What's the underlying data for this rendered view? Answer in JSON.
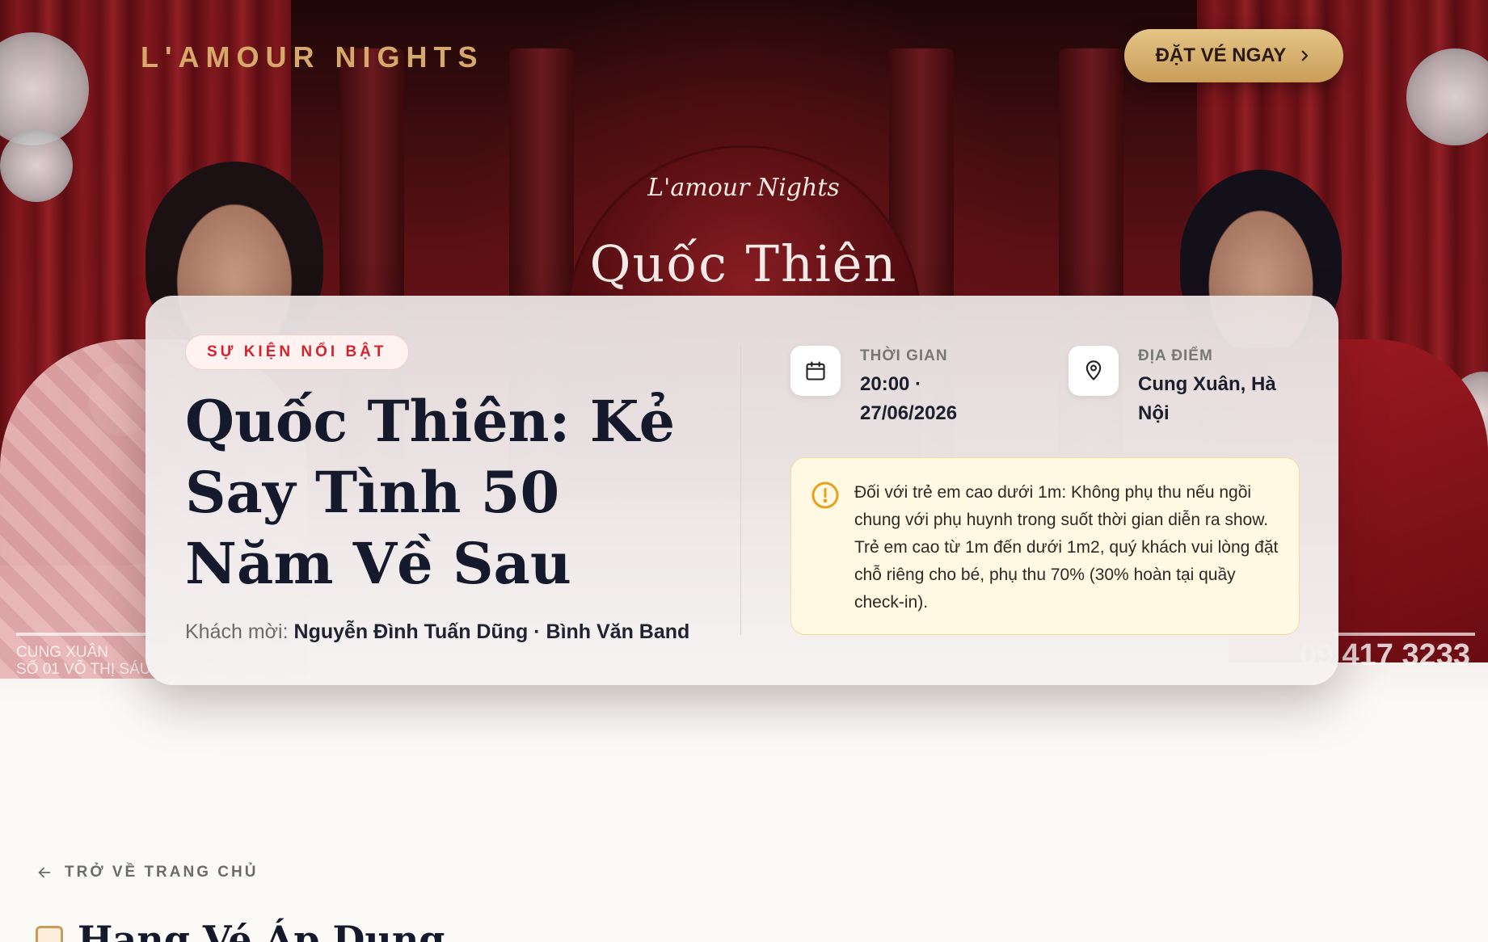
{
  "header": {
    "brand": "L'AMOUR NIGHTS",
    "cta_label": "ĐẶT VÉ NGAY"
  },
  "poster": {
    "logo_script": "L'amour Nights",
    "artist_name": "Quốc Thiên",
    "venue_small_1": "CUNG XUÂN",
    "venue_small_2": "SỐ 01 VÕ THỊ SÁU",
    "phone": "09 417 3233"
  },
  "event": {
    "badge": "SỰ KIỆN NỔI BẬT",
    "title": "Quốc Thiên: Kẻ Say Tình 50 Năm Về Sau",
    "guests_label": "Khách mời:",
    "guests_value": "Nguyễn Đình Tuấn Dũng · Bình Văn Band",
    "time_label": "THỜI GIAN",
    "time_value": "20:00 · 27/06/2026",
    "location_label": "ĐỊA ĐIỂM",
    "location_value": "Cung Xuân, Hà Nội",
    "notice": "Đối với trẻ em cao dưới 1m: Không phụ thu nếu ngồi chung với phụ huynh trong suốt thời gian diễn ra show. Trẻ em cao từ 1m đến dưới 1m2, quý khách vui lòng đặt chỗ riêng cho bé, phụ thu 70% (30% hoàn tại quầy check-in)."
  },
  "nav": {
    "back_label": "TRỞ VỀ TRANG CHỦ"
  },
  "section": {
    "title": "Hạng Vé Áp Dụng"
  },
  "colors": {
    "gold": "#d6a96a",
    "badge_red": "#d3242e",
    "notice_bg": "#fff8e3",
    "notice_icon": "#e6a21b"
  },
  "icons": {
    "cta": "chevron-right-icon",
    "time": "calendar-icon",
    "location": "map-pin-icon",
    "notice": "alert-circle-icon",
    "back": "arrow-left-icon",
    "section": "ticket-icon"
  }
}
